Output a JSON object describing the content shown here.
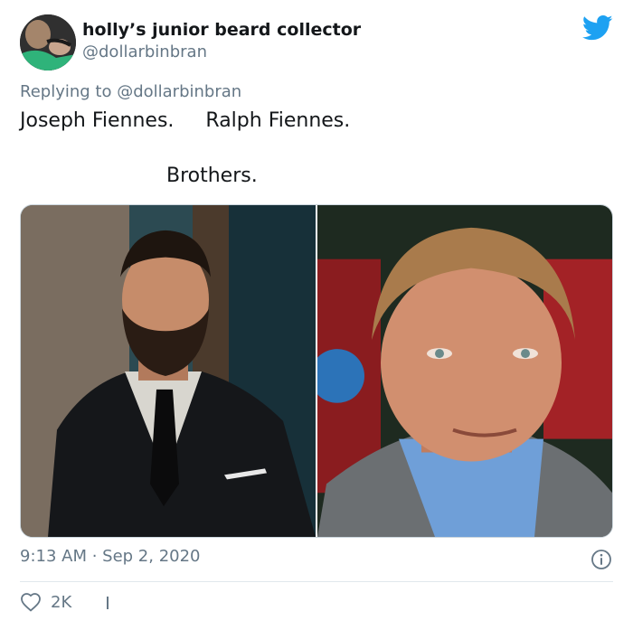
{
  "user": {
    "display_name": "holly’s junior beard collector",
    "handle": "@dollarbinbran"
  },
  "reply": {
    "prefix": "Replying to ",
    "mention": "@dollarbinbran"
  },
  "tweet": {
    "line1": "Joseph Fiennes.     Ralph Fiennes.",
    "line2": "Brothers."
  },
  "meta": {
    "timestamp": "9:13 AM · Sep 2, 2020"
  },
  "actions": {
    "like_count": "2K"
  },
  "colors": {
    "twitter_blue": "#1da1f2",
    "secondary_text": "#657786",
    "primary_text": "#14171a"
  },
  "icons": [
    "twitter-bird-icon",
    "info-icon",
    "heart-icon"
  ]
}
